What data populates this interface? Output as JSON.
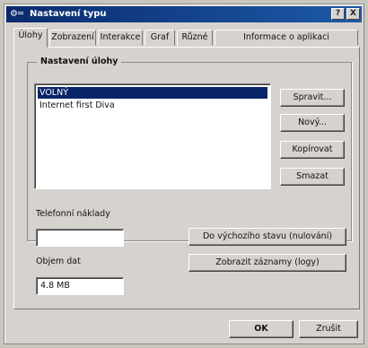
{
  "window": {
    "title": "Nastavení typu",
    "icon": "app-icon",
    "help_label": "?",
    "close_label": "X"
  },
  "tabs": [
    {
      "label": "Úlohy"
    },
    {
      "label": "Zobrazení"
    },
    {
      "label": "Interakce"
    },
    {
      "label": "Graf"
    },
    {
      "label": "Různé"
    },
    {
      "label": "Informace o aplikaci"
    }
  ],
  "group": {
    "label": "Nastavení úlohy",
    "list_items": [
      {
        "label": "VOLNÝ"
      },
      {
        "label": "Internet first Diva"
      }
    ]
  },
  "side_buttons": {
    "new_label": "Spravit...",
    "edit_label": "Nový...",
    "copy_label": "Kopírovat",
    "delete_label": "Smazat"
  },
  "cost": {
    "label": "Telefonní náklady",
    "value": ""
  },
  "volume": {
    "label": "Objem dat",
    "value": "4.8 MB"
  },
  "action_buttons": {
    "reset_label": "Do výchozího stavu (nulování)",
    "show_label": "Zobrazit záznamy (logy)"
  },
  "footer": {
    "ok_label": "OK",
    "cancel_label": "Zrušit"
  }
}
